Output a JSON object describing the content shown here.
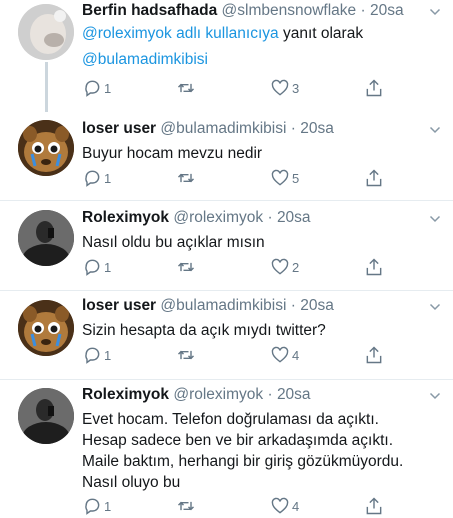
{
  "tweets": [
    {
      "name": "Berfin hadsafhada",
      "handle": "@slmbensnowflake",
      "time": "20sa",
      "reply_prefix_mention": "@roleximyok",
      "reply_prefix_text": " adlı kullanıcıya",
      "reply_suffix_text": " yanıt olarak",
      "mention_line": "@bulamadimkibisi",
      "replies": "1",
      "likes": "3"
    },
    {
      "name": "loser user",
      "handle": "@bulamadimkibisi",
      "time": "20sa",
      "text": "Buyur hocam mevzu nedir",
      "replies": "1",
      "likes": "5"
    },
    {
      "name": "Roleximyok",
      "handle": "@roleximyok",
      "time": "20sa",
      "text": "Nasıl oldu bu açıklar mısın",
      "replies": "1",
      "likes": "2"
    },
    {
      "name": "loser user",
      "handle": "@bulamadimkibisi",
      "time": "20sa",
      "text": "Sizin hesapta da açık mıydı twitter?",
      "replies": "1",
      "likes": "4"
    },
    {
      "name": "Roleximyok",
      "handle": "@roleximyok",
      "time": "20sa",
      "text_lines": [
        "Evet hocam. Telefon doğrulaması da açıktı.",
        "Hesap sadece ben ve bir arkadaşımda açıktı.",
        "Maile baktım, herhangi bir giriş gözükmüyordu.",
        "Nasıl oluyo bu"
      ],
      "replies": "1",
      "likes": "4"
    }
  ],
  "separator": "·",
  "colors": {
    "link": "#1b95e0",
    "muted": "#657786",
    "thread_line": "#ccd6dd",
    "divider": "#e6ecf0"
  },
  "icons": [
    "reply-icon",
    "retweet-icon",
    "like-icon",
    "share-icon",
    "chevron-down-icon"
  ]
}
